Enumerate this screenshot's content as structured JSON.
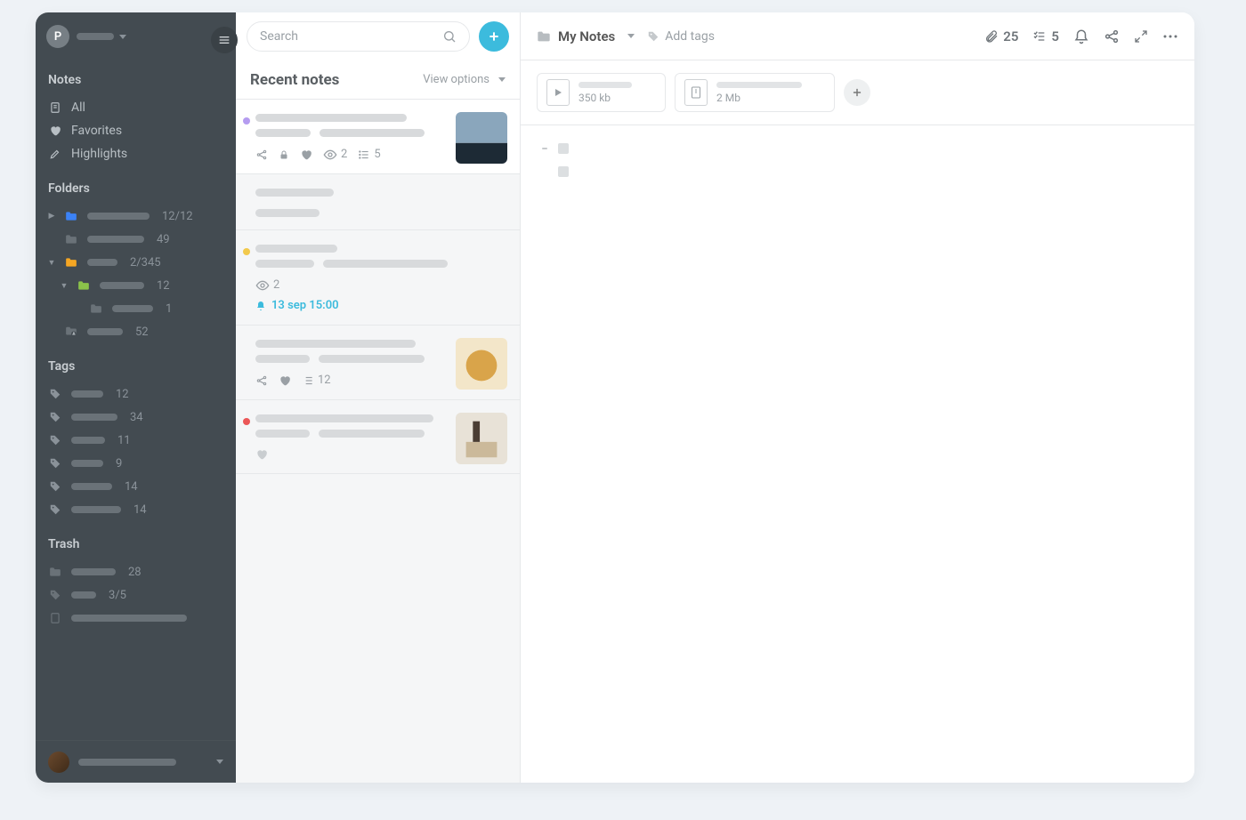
{
  "sidebar": {
    "avatar_letter": "P",
    "sections": {
      "notes": {
        "heading": "Notes",
        "items": [
          {
            "label": "All",
            "icon": "note"
          },
          {
            "label": "Favorites",
            "icon": "heart"
          },
          {
            "label": "Highlights",
            "icon": "highlight"
          }
        ]
      },
      "folders": {
        "heading": "Folders",
        "items": [
          {
            "count": "12/12",
            "color": "#3b82f6",
            "caret": "right"
          },
          {
            "count": "49",
            "color": "#6a7278"
          },
          {
            "count": "2/345",
            "color": "#f5a623",
            "caret": "down"
          },
          {
            "count": "12",
            "color": "#8bc34a",
            "caret": "down",
            "indent": 1
          },
          {
            "count": "1",
            "color": "#6a7278",
            "indent": 2
          },
          {
            "count": "52",
            "color": "#6a7278",
            "shared": true
          }
        ]
      },
      "tags": {
        "heading": "Tags",
        "items": [
          {
            "count": "12"
          },
          {
            "count": "34"
          },
          {
            "count": "11"
          },
          {
            "count": "9"
          },
          {
            "count": "14"
          },
          {
            "count": "14"
          }
        ]
      },
      "trash": {
        "heading": "Trash",
        "items": [
          {
            "icon": "folder",
            "count": "28"
          },
          {
            "icon": "tag",
            "count": "3/5"
          },
          {
            "icon": "note",
            "count": ""
          }
        ]
      }
    }
  },
  "midcol": {
    "search_placeholder": "Search",
    "title": "Recent notes",
    "view_options": "View options",
    "notes": [
      {
        "dot": "#b59cf0",
        "selected": true,
        "thumb": "landscape",
        "views": "2",
        "list_count": "5",
        "has_share": true,
        "has_lock": true,
        "has_fav": true
      },
      {
        "dot": null
      },
      {
        "dot": "#f2c94c",
        "views": "2",
        "reminder": "13 sep 15:00"
      },
      {
        "thumb": "dog",
        "list_count": "12",
        "has_share": true,
        "has_fav": true
      },
      {
        "dot": "#eb5757",
        "thumb": "coffee",
        "has_fav": true
      }
    ]
  },
  "noteview": {
    "breadcrumb": "My Notes",
    "add_tags": "Add tags",
    "attach_count": "25",
    "task_count": "5",
    "attachments": [
      {
        "type": "video",
        "size": "350 kb"
      },
      {
        "type": "archive",
        "size": "2 Mb"
      }
    ]
  }
}
